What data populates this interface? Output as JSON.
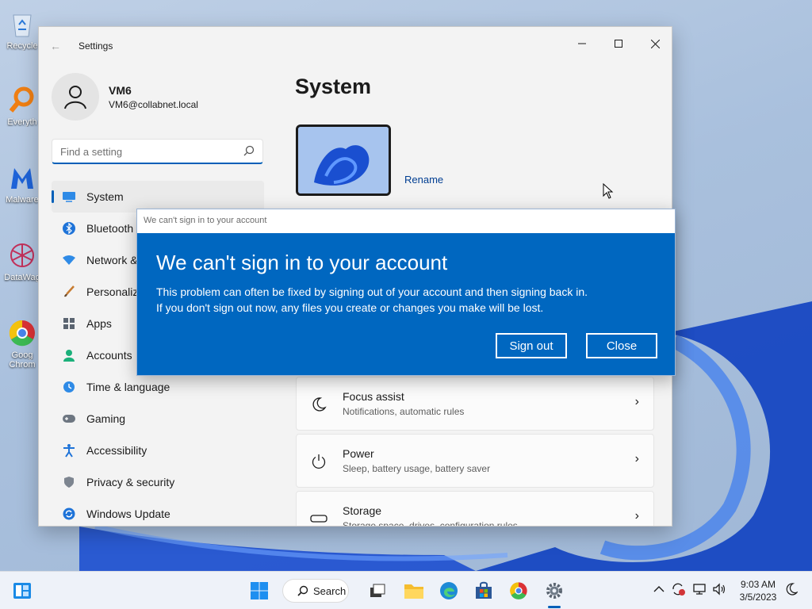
{
  "desktop": {
    "icons": [
      {
        "label": "Recycle",
        "icon": "recycle-bin-icon"
      },
      {
        "label": "Everyth",
        "icon": "everything-search-icon"
      },
      {
        "label": "Malware",
        "icon": "malwarebytes-icon"
      },
      {
        "label": "DataWag",
        "icon": "datawagon-icon"
      },
      {
        "label": "Goog",
        "label2": "Chrom",
        "icon": "chrome-icon"
      }
    ]
  },
  "settings": {
    "title": "Settings",
    "user": {
      "name": "VM6",
      "email": "VM6@collabnet.local"
    },
    "search": {
      "placeholder": "Find a setting"
    },
    "nav": [
      {
        "label": "System",
        "icon": "system-icon",
        "active": true
      },
      {
        "label": "Bluetooth",
        "icon": "bluetooth-icon"
      },
      {
        "label": "Network &",
        "icon": "network-icon"
      },
      {
        "label": "Personaliz",
        "icon": "personalization-icon"
      },
      {
        "label": "Apps",
        "icon": "apps-icon"
      },
      {
        "label": "Accounts",
        "icon": "accounts-icon"
      },
      {
        "label": "Time & language",
        "icon": "time-language-icon"
      },
      {
        "label": "Gaming",
        "icon": "gaming-icon"
      },
      {
        "label": "Accessibility",
        "icon": "accessibility-icon"
      },
      {
        "label": "Privacy & security",
        "icon": "privacy-shield-icon"
      },
      {
        "label": "Windows Update",
        "icon": "windows-update-icon"
      }
    ],
    "page_title": "System",
    "rename_label": "Rename",
    "cards": [
      {
        "title": "Focus assist",
        "subtitle": "Notifications, automatic rules",
        "icon": "moon-icon"
      },
      {
        "title": "Power",
        "subtitle": "Sleep, battery usage, battery saver",
        "icon": "power-icon"
      },
      {
        "title": "Storage",
        "subtitle": "Storage space, drives, configuration rules",
        "icon": "storage-icon"
      }
    ],
    "chevron": "›"
  },
  "dialog": {
    "titlebar": "We can't sign in to your account",
    "heading": "We can't sign in to your account",
    "line1": "This problem can often be fixed by signing out of your account and then signing back in.",
    "line2": "If you don't sign out now, any files you create or changes you make will be lost.",
    "sign_out": "Sign out",
    "close": "Close"
  },
  "taskbar": {
    "search_label": "Search",
    "clock_time": "9:03 AM",
    "clock_date": "3/5/2023",
    "accent": "#005fb8"
  }
}
